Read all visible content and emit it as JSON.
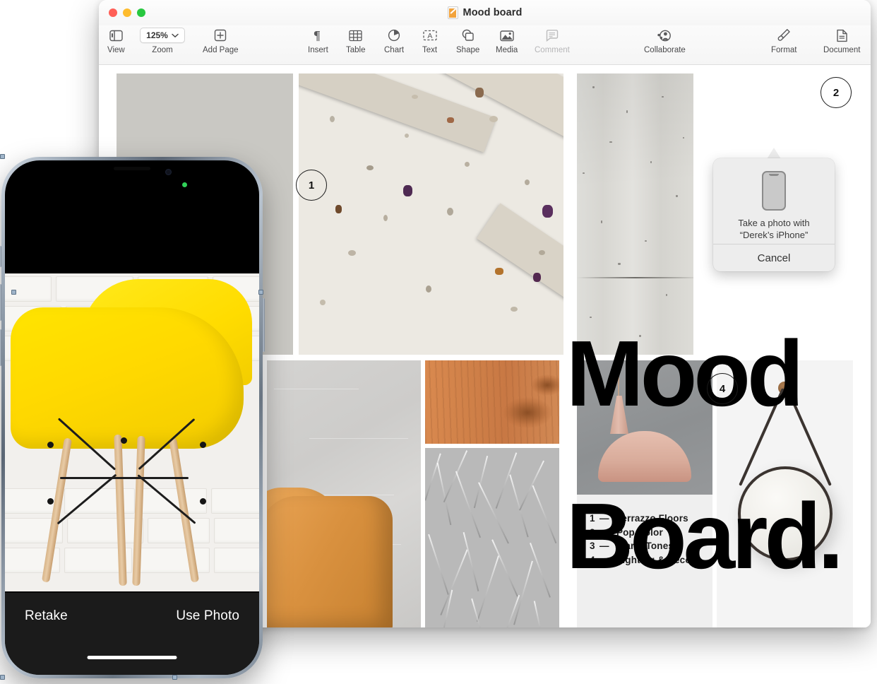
{
  "window": {
    "title": "Mood board",
    "doc_icon": "pages-document-icon",
    "traffic_lights": [
      {
        "name": "close",
        "color": "#ff5f57"
      },
      {
        "name": "minimize",
        "color": "#febc2e"
      },
      {
        "name": "maximize",
        "color": "#28c840"
      }
    ]
  },
  "toolbar": {
    "items": [
      {
        "label": "View",
        "icon": "sidebar-icon",
        "disabled": false
      },
      {
        "label": "Zoom",
        "icon": "zoom-chevron-icon",
        "disabled": false,
        "value": "125%"
      },
      {
        "label": "Add Page",
        "icon": "add-page-icon",
        "disabled": false
      },
      {
        "label": "Insert",
        "icon": "pilcrow-icon",
        "disabled": false
      },
      {
        "label": "Table",
        "icon": "table-icon",
        "disabled": false
      },
      {
        "label": "Chart",
        "icon": "pie-chart-icon",
        "disabled": false
      },
      {
        "label": "Text",
        "icon": "text-box-icon",
        "disabled": false
      },
      {
        "label": "Shape",
        "icon": "shape-icon",
        "disabled": false
      },
      {
        "label": "Media",
        "icon": "media-image-icon",
        "disabled": false
      },
      {
        "label": "Comment",
        "icon": "comment-bubble-icon",
        "disabled": true
      },
      {
        "label": "Collaborate",
        "icon": "collaborate-person-icon",
        "disabled": false
      },
      {
        "label": "Format",
        "icon": "paintbrush-icon",
        "disabled": false
      },
      {
        "label": "Document",
        "icon": "document-page-icon",
        "disabled": false
      }
    ],
    "zoom_value": "125%"
  },
  "document": {
    "display_title_line1": "Mood",
    "display_title_line2": "Board.",
    "markers": [
      {
        "number": "1"
      },
      {
        "number": "2"
      },
      {
        "number": "4"
      }
    ],
    "legend": [
      {
        "num": "1",
        "dash": "—",
        "label": "Terrazzo Floors"
      },
      {
        "num": "2",
        "dash": "—",
        "label": "Pop Color"
      },
      {
        "num": "3",
        "dash": "—",
        "label": "Warm Tones"
      },
      {
        "num": "4",
        "dash": "—",
        "label": "Lighting & Decor"
      }
    ],
    "tiles": [
      {
        "name": "gray-backdrop-photo"
      },
      {
        "name": "terrazzo-slab-photo"
      },
      {
        "name": "concrete-wall-photo"
      },
      {
        "name": "plaster-wall-sofa-photo"
      },
      {
        "name": "wood-grain-photo"
      },
      {
        "name": "fur-rug-photo"
      },
      {
        "name": "pendant-lamp-photo"
      },
      {
        "name": "round-mirror-photo"
      }
    ]
  },
  "popover": {
    "icon": "iphone-device-icon",
    "message_line1": "Take a photo with",
    "message_line2": "“Derek’s iPhone”",
    "cancel_label": "Cancel"
  },
  "iphone": {
    "retake_label": "Retake",
    "use_photo_label": "Use Photo",
    "status_indicator": "camera-in-use-green-dot",
    "preview": "yellow-eames-chair-photo"
  },
  "colors": {
    "accent_yellow": "#ffd900",
    "terrazzo_bg": "#ece9e2",
    "sofa_tan": "#d9913f",
    "wood": "#cf8048",
    "lamp_blush": "#d9ac9b",
    "green_dot": "#30d158"
  }
}
